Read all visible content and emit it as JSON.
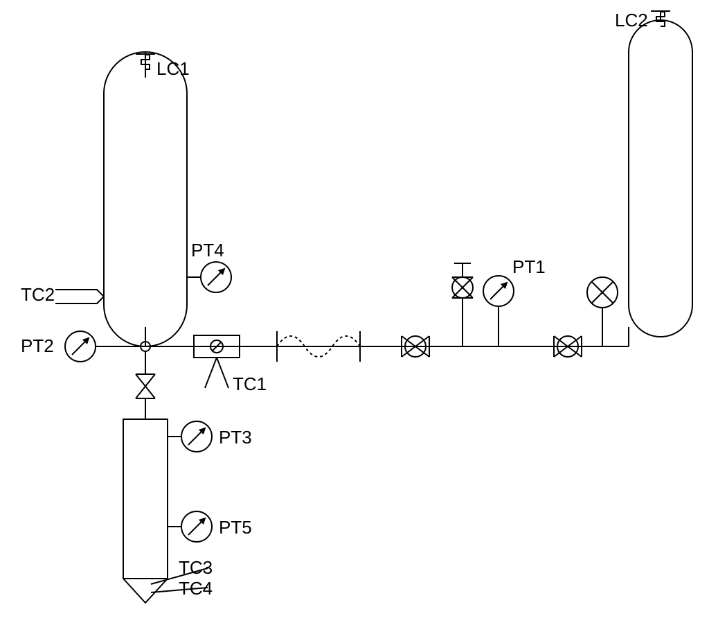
{
  "labels": {
    "lc1": "LC1",
    "lc2": "LC2",
    "pt1": "PT1",
    "pt2": "PT2",
    "pt3": "PT3",
    "pt4": "PT4",
    "pt5": "PT5",
    "tc1": "TC1",
    "tc2": "TC2",
    "tc3": "TC3",
    "tc4": "TC4"
  },
  "instruments": [
    {
      "tag": "LC1",
      "type": "load-cell",
      "attached_to": "vessel-left"
    },
    {
      "tag": "LC2",
      "type": "load-cell",
      "attached_to": "vessel-right"
    },
    {
      "tag": "PT1",
      "type": "pressure-transmitter"
    },
    {
      "tag": "PT2",
      "type": "pressure-transmitter"
    },
    {
      "tag": "PT3",
      "type": "pressure-transmitter"
    },
    {
      "tag": "PT4",
      "type": "pressure-transmitter"
    },
    {
      "tag": "PT5",
      "type": "pressure-transmitter"
    },
    {
      "tag": "TC1",
      "type": "thermocouple"
    },
    {
      "tag": "TC2",
      "type": "thermocouple"
    },
    {
      "tag": "TC3",
      "type": "thermocouple"
    },
    {
      "tag": "TC4",
      "type": "thermocouple"
    }
  ],
  "equipment": [
    {
      "id": "vessel-left",
      "type": "cylinder-vessel"
    },
    {
      "id": "vessel-right",
      "type": "cylinder-vessel"
    },
    {
      "id": "lower-column",
      "type": "column"
    }
  ]
}
